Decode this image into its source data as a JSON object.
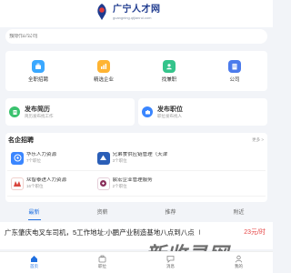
{
  "header": {
    "logo_title": "广宁人才网",
    "logo_domain": "guangning.qtjianrui.com"
  },
  "search": {
    "placeholder": "搜职位/公司"
  },
  "quick": [
    {
      "label": "全职招聘",
      "icon": "briefcase-icon",
      "color": "#3aa8ff"
    },
    {
      "label": "精选企业",
      "icon": "chart-icon",
      "color": "#ffb432"
    },
    {
      "label": "找兼职",
      "icon": "user-icon",
      "color": "#34c48b"
    },
    {
      "label": "公司",
      "icon": "building-icon",
      "color": "#4b7bec"
    }
  ],
  "cards": [
    {
      "title": "发布简历",
      "sub": "简历发布找工作",
      "icon": "resume-icon",
      "color": "#3ac26e"
    },
    {
      "title": "发布职位",
      "sub": "职位发布找人",
      "icon": "post-icon",
      "color": "#3a86ff"
    }
  ],
  "famous": {
    "title": "名企招聘",
    "more": "更多 >"
  },
  "companies": [
    {
      "name": "华乐人力资源",
      "count": "7个职位",
      "color": "#3a86ff"
    },
    {
      "name": "兄弟食供应链管理（天津",
      "count": "3个职位",
      "color": "#2b5fb8"
    },
    {
      "name": "",
      "count": "",
      "color": "#ffffff"
    },
    {
      "name": "众智泰进人力资源",
      "count": "16个职位",
      "color": "#d9443b"
    },
    {
      "name": "宸宏企业管理服务",
      "count": "2个职位",
      "color": "#8a2f5b"
    },
    {
      "name": "",
      "count": "",
      "color": "#ffffff"
    }
  ],
  "tabs": [
    {
      "label": "最新"
    },
    {
      "label": "资薪"
    },
    {
      "label": "推荐"
    },
    {
      "label": "附近"
    }
  ],
  "job": {
    "title": "广东肇庆电叉车司机，5工作地址:小鹏产业制造基地八点到八点（中途休...",
    "salary": "23元/时"
  },
  "watermark": "新收录网",
  "bottom_nav": [
    {
      "label": "首页",
      "icon": "home-icon"
    },
    {
      "label": "职位",
      "icon": "job-icon"
    },
    {
      "label": "消息",
      "icon": "message-icon"
    },
    {
      "label": "我的",
      "icon": "profile-icon"
    }
  ]
}
